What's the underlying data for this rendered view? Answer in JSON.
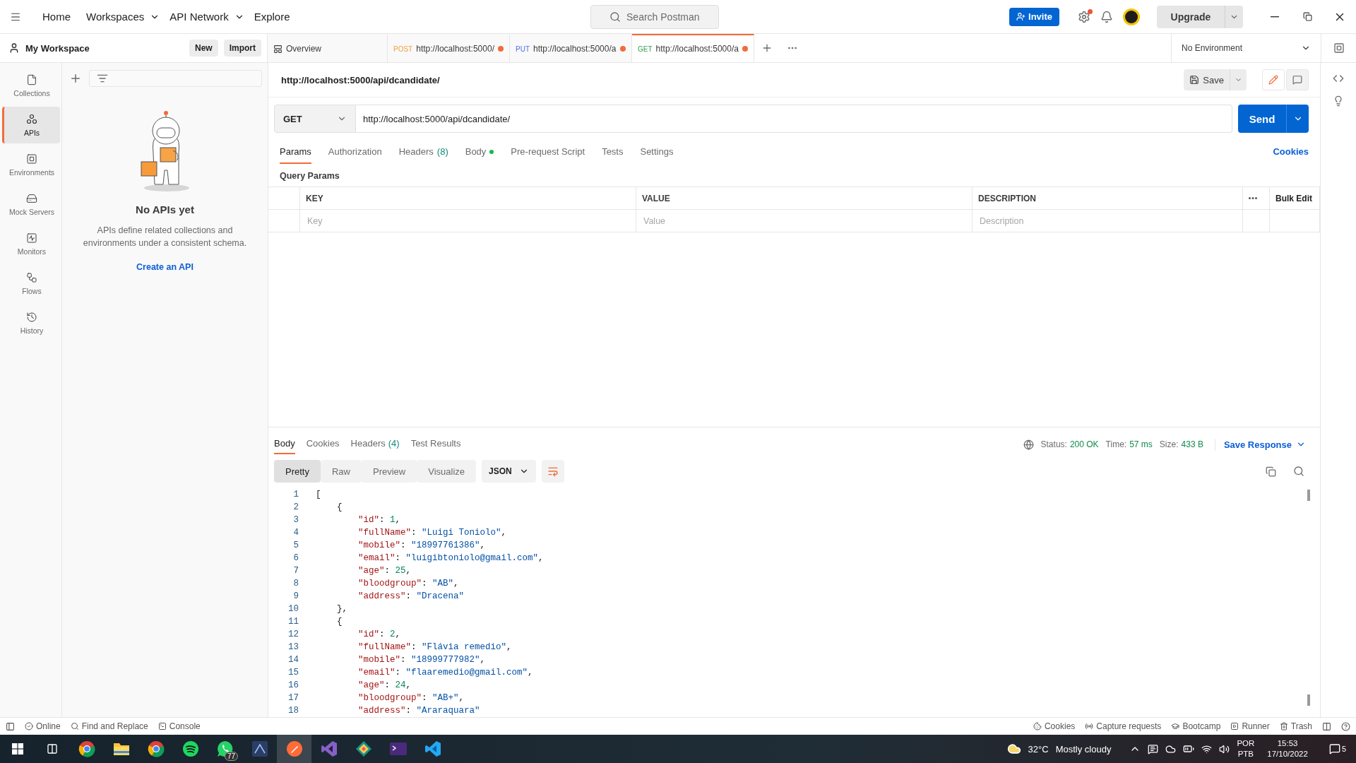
{
  "topbar": {
    "nav": [
      {
        "label": "Home",
        "dropdown": false
      },
      {
        "label": "Workspaces",
        "dropdown": true
      },
      {
        "label": "API Network",
        "dropdown": true
      },
      {
        "label": "Explore",
        "dropdown": false
      }
    ],
    "search": {
      "placeholder": "Search Postman"
    },
    "invite": "Invite",
    "notification_dot": true,
    "upgrade": "Upgrade"
  },
  "workspace": {
    "name": "My Workspace",
    "buttons": [
      "New",
      "Import"
    ]
  },
  "tabs": [
    {
      "kind": "overview",
      "label": "Overview",
      "selected": false
    },
    {
      "kind": "request",
      "method": "POST",
      "color": "#f09d3e",
      "label": "http://localhost:5000/",
      "unsaved": true,
      "selected": false
    },
    {
      "kind": "request",
      "method": "PUT",
      "color": "#4d6ee8",
      "label": "http://localhost:5000/a",
      "unsaved": true,
      "selected": false
    },
    {
      "kind": "request",
      "method": "GET",
      "color": "#2e9e53",
      "label": "http://localhost:5000/a",
      "unsaved": true,
      "selected": true
    }
  ],
  "environment": "No Environment",
  "sidebar": {
    "items": [
      {
        "label": "Collections",
        "selected": false
      },
      {
        "label": "APIs",
        "selected": true
      },
      {
        "label": "Environments",
        "selected": false
      },
      {
        "label": "Mock Servers",
        "selected": false
      },
      {
        "label": "Monitors",
        "selected": false
      },
      {
        "label": "Flows",
        "selected": false
      },
      {
        "label": "History",
        "selected": false
      }
    ]
  },
  "apis_panel": {
    "title": "No APIs yet",
    "description": "APIs define related collections and environments under a consistent schema.",
    "link": "Create an API"
  },
  "request": {
    "title": "http://localhost:5000/api/dcandidate/",
    "save": "Save",
    "method": "GET",
    "url": "http://localhost:5000/api/dcandidate/",
    "send": "Send",
    "tabs": [
      {
        "label": "Params",
        "selected": true,
        "dot": false
      },
      {
        "label": "Authorization",
        "selected": false,
        "dot": false
      },
      {
        "label": "Headers",
        "count": "(8)",
        "selected": false,
        "dot": false
      },
      {
        "label": "Body",
        "selected": false,
        "dot": true
      },
      {
        "label": "Pre-request Script",
        "selected": false,
        "dot": false
      },
      {
        "label": "Tests",
        "selected": false,
        "dot": false
      },
      {
        "label": "Settings",
        "selected": false,
        "dot": false
      }
    ],
    "cookies": "Cookies",
    "section": "Query Params",
    "columns": [
      "KEY",
      "VALUE",
      "DESCRIPTION"
    ],
    "bulk_edit": "Bulk Edit",
    "placeholders": [
      "Key",
      "Value",
      "Description"
    ]
  },
  "response": {
    "tabs": [
      {
        "label": "Body",
        "selected": true
      },
      {
        "label": "Cookies",
        "selected": false
      },
      {
        "label": "Headers",
        "count": "(4)",
        "selected": false
      },
      {
        "label": "Test Results",
        "selected": false
      }
    ],
    "stats": [
      {
        "label": "Status:",
        "value": "200 OK",
        "color": "#0f8a4c"
      },
      {
        "label": "Time:",
        "value": "57 ms",
        "color": "#0f8a4c"
      },
      {
        "label": "Size:",
        "value": "433 B",
        "color": "#0f8a4c"
      }
    ],
    "save_response": "Save Response",
    "views": [
      {
        "label": "Pretty",
        "selected": true
      },
      {
        "label": "Raw",
        "selected": false
      },
      {
        "label": "Preview",
        "selected": false
      },
      {
        "label": "Visualize",
        "selected": false
      }
    ],
    "format": "JSON",
    "code": [
      {
        "n": "1",
        "kind": "array",
        "tokens": [
          {
            "kind": "punct",
            "text": "["
          }
        ]
      },
      {
        "n": "2",
        "kind": "object",
        "tokens": [
          {
            "kind": "punct",
            "text": "{"
          }
        ]
      },
      {
        "n": "3",
        "kind": "member",
        "tokens": [
          {
            "kind": "key",
            "text": "\"id\""
          },
          {
            "kind": "punct",
            "text": ": "
          },
          {
            "kind": "number",
            "text": "1"
          },
          {
            "kind": "punct",
            "text": ","
          }
        ]
      },
      {
        "n": "4",
        "kind": "member",
        "tokens": [
          {
            "kind": "key",
            "text": "\"fullName\""
          },
          {
            "kind": "punct",
            "text": ": "
          },
          {
            "kind": "string",
            "text": "\"Luigi Toniolo\""
          },
          {
            "kind": "punct",
            "text": ","
          }
        ]
      },
      {
        "n": "5",
        "kind": "member",
        "tokens": [
          {
            "kind": "key",
            "text": "\"mobile\""
          },
          {
            "kind": "punct",
            "text": ": "
          },
          {
            "kind": "string",
            "text": "\"18997761386\""
          },
          {
            "kind": "punct",
            "text": ","
          }
        ]
      },
      {
        "n": "6",
        "kind": "member",
        "tokens": [
          {
            "kind": "key",
            "text": "\"email\""
          },
          {
            "kind": "punct",
            "text": ": "
          },
          {
            "kind": "string",
            "text": "\"luigibtoniolo@gmail.com\""
          },
          {
            "kind": "punct",
            "text": ","
          }
        ]
      },
      {
        "n": "7",
        "kind": "member",
        "tokens": [
          {
            "kind": "key",
            "text": "\"age\""
          },
          {
            "kind": "punct",
            "text": ": "
          },
          {
            "kind": "number",
            "text": "25"
          },
          {
            "kind": "punct",
            "text": ","
          }
        ]
      },
      {
        "n": "8",
        "kind": "member",
        "tokens": [
          {
            "kind": "key",
            "text": "\"bloodgroup\""
          },
          {
            "kind": "punct",
            "text": ": "
          },
          {
            "kind": "string",
            "text": "\"AB\""
          },
          {
            "kind": "punct",
            "text": ","
          }
        ]
      },
      {
        "n": "9",
        "kind": "member",
        "tokens": [
          {
            "kind": "key",
            "text": "\"address\""
          },
          {
            "kind": "punct",
            "text": ": "
          },
          {
            "kind": "string",
            "text": "\"Dracena\""
          }
        ]
      },
      {
        "n": "10",
        "kind": "object",
        "tokens": [
          {
            "kind": "punct",
            "text": "},"
          }
        ]
      },
      {
        "n": "11",
        "kind": "object",
        "tokens": [
          {
            "kind": "punct",
            "text": "{"
          }
        ]
      },
      {
        "n": "12",
        "kind": "member",
        "tokens": [
          {
            "kind": "key",
            "text": "\"id\""
          },
          {
            "kind": "punct",
            "text": ": "
          },
          {
            "kind": "number",
            "text": "2"
          },
          {
            "kind": "punct",
            "text": ","
          }
        ]
      },
      {
        "n": "13",
        "kind": "member",
        "tokens": [
          {
            "kind": "key",
            "text": "\"fullName\""
          },
          {
            "kind": "punct",
            "text": ": "
          },
          {
            "kind": "string",
            "text": "\"Flávia remedio\""
          },
          {
            "kind": "punct",
            "text": ","
          }
        ]
      },
      {
        "n": "14",
        "kind": "member",
        "tokens": [
          {
            "kind": "key",
            "text": "\"mobile\""
          },
          {
            "kind": "punct",
            "text": ": "
          },
          {
            "kind": "string",
            "text": "\"18999777982\""
          },
          {
            "kind": "punct",
            "text": ","
          }
        ]
      },
      {
        "n": "15",
        "kind": "member",
        "tokens": [
          {
            "kind": "key",
            "text": "\"email\""
          },
          {
            "kind": "punct",
            "text": ": "
          },
          {
            "kind": "string",
            "text": "\"flaaremedio@gmail.com\""
          },
          {
            "kind": "punct",
            "text": ","
          }
        ]
      },
      {
        "n": "16",
        "kind": "member",
        "tokens": [
          {
            "kind": "key",
            "text": "\"age\""
          },
          {
            "kind": "punct",
            "text": ": "
          },
          {
            "kind": "number",
            "text": "24"
          },
          {
            "kind": "punct",
            "text": ","
          }
        ]
      },
      {
        "n": "17",
        "kind": "member",
        "tokens": [
          {
            "kind": "key",
            "text": "\"bloodgroup\""
          },
          {
            "kind": "punct",
            "text": ": "
          },
          {
            "kind": "string",
            "text": "\"AB+\""
          },
          {
            "kind": "punct",
            "text": ","
          }
        ]
      },
      {
        "n": "18",
        "kind": "member",
        "tokens": [
          {
            "kind": "key",
            "text": "\"address\""
          },
          {
            "kind": "punct",
            "text": ": "
          },
          {
            "kind": "string",
            "text": "\"Araraquara\""
          }
        ]
      }
    ]
  },
  "status_bar": {
    "left": [
      "Online",
      "Find and Replace",
      "Console"
    ],
    "right": [
      "Cookies",
      "Capture requests",
      "Bootcamp",
      "Runner",
      "Trash"
    ]
  },
  "taskbar": {
    "apps": [
      {
        "kind": "chrome",
        "selected": false
      },
      {
        "kind": "folder",
        "selected": false
      },
      {
        "kind": "chrome",
        "selected": false
      },
      {
        "kind": "spotify",
        "selected": false
      },
      {
        "kind": "whatsapp",
        "selected": false,
        "badge": "77"
      },
      {
        "kind": "ssms",
        "selected": false
      },
      {
        "kind": "postman",
        "selected": true
      },
      {
        "kind": "vs",
        "selected": false
      },
      {
        "kind": "gitkraken",
        "selected": false
      },
      {
        "kind": "terminal",
        "selected": false
      },
      {
        "kind": "vscode",
        "selected": false
      }
    ],
    "temperature": "32°C",
    "weather": "Mostly cloudy",
    "language": [
      "POR",
      "PTB"
    ],
    "time": "15:53",
    "date": "17/10/2022",
    "notifications": "5"
  }
}
